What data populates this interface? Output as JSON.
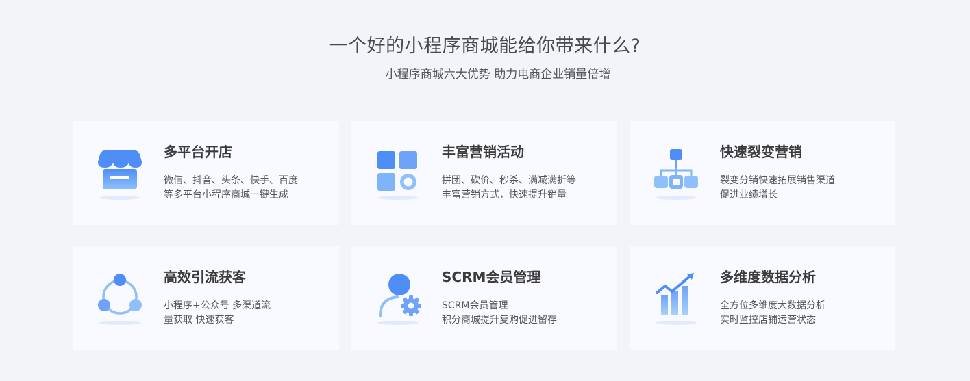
{
  "header": {
    "title": "一个好的小程序商城能给你带来什么?",
    "subtitle": "小程序商城六大优势 助力电商企业销量倍增"
  },
  "features": [
    {
      "icon": "store-icon",
      "title": "多平台开店",
      "desc_lines": [
        "微信、抖音、头条、快手、百度",
        "等多平台小程序商城一键生成"
      ]
    },
    {
      "icon": "grid-apps-icon",
      "title": "丰富营销活动",
      "desc_lines": [
        "拼团、砍价、秒杀、满减满折等",
        "丰富营销方式，快速提升销量"
      ]
    },
    {
      "icon": "network-tree-icon",
      "title": "快速裂变营销",
      "desc_lines": [
        "裂变分销快速拓展销售渠道",
        "促进业绩增长"
      ]
    },
    {
      "icon": "cycle-nodes-icon",
      "title": "高效引流获客",
      "desc_lines": [
        "小程序+公众号 多渠道流",
        "量获取 快速获客"
      ]
    },
    {
      "icon": "user-gear-icon",
      "title": "SCRM会员管理",
      "desc_lines": [
        "SCRM会员管理",
        "积分商城提升复购促进留存"
      ]
    },
    {
      "icon": "bar-chart-trend-icon",
      "title": "多维度数据分析",
      "desc_lines": [
        "全方位多维度大数据分析",
        "实时监控店铺运营状态"
      ]
    }
  ],
  "colors": {
    "background": "#f3f4f9",
    "card": "#f9faff",
    "icon_primary": "#4f8ef7",
    "icon_light": "#8fc0fb"
  }
}
